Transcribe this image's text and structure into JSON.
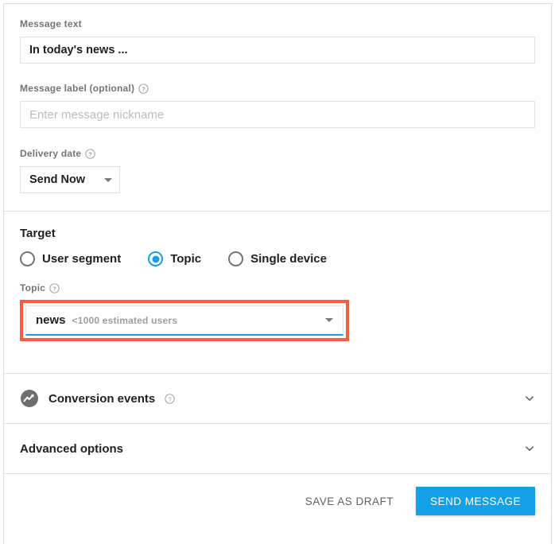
{
  "colors": {
    "accent_blue": "#14a0e6",
    "highlight_red": "#f4603e",
    "underline_blue": "#1d9bdb",
    "label_gray": "#757575",
    "text_dark": "#212121"
  },
  "message_text": {
    "label": "Message text",
    "value": "In today's news ..."
  },
  "message_label": {
    "label": "Message label (optional)",
    "help_icon": "help-circle-icon",
    "placeholder": "Enter message nickname",
    "value": ""
  },
  "delivery_date": {
    "label": "Delivery date",
    "help_icon": "help-circle-icon",
    "selected": "Send Now",
    "caret_icon": "caret-down-icon"
  },
  "target": {
    "title": "Target",
    "options": [
      {
        "label": "User segment",
        "selected": false
      },
      {
        "label": "Topic",
        "selected": true
      },
      {
        "label": "Single device",
        "selected": false
      }
    ],
    "topic": {
      "label": "Topic",
      "help_icon": "help-circle-icon",
      "value": "news",
      "estimate": "<1000 estimated users",
      "caret_icon": "caret-down-icon",
      "highlighted": true
    }
  },
  "conversion_events": {
    "title": "Conversion events",
    "icon": "analytics-trend-icon",
    "help_icon": "help-circle-icon",
    "chevron_icon": "chevron-down-icon"
  },
  "advanced_options": {
    "title": "Advanced options",
    "chevron_icon": "chevron-down-icon"
  },
  "footer": {
    "save_draft_label": "SAVE AS DRAFT",
    "send_message_label": "SEND MESSAGE"
  }
}
